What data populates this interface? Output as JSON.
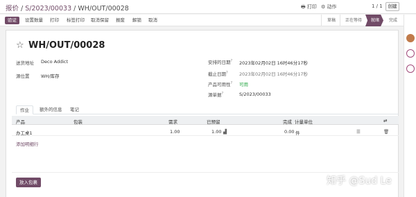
{
  "topbar": {
    "breadcrumb_root": "报价",
    "breadcrumb_sep1": "/",
    "breadcrumb_mid": "S/2023/00033",
    "breadcrumb_sep2": "/",
    "breadcrumb_current": "WH/OUT/00028",
    "print_label": "打印",
    "action_label": "动作",
    "pager": "1 / 1",
    "create_label": "创建"
  },
  "statusbar": {
    "validate": "验证",
    "set_quantities": "设置数量",
    "print": "打印",
    "print_labels": "标签打印",
    "cancel_reservation": "取消保留",
    "scrap": "报废",
    "unlock": "解锁",
    "cancel": "取消",
    "stages": [
      "草稿",
      "正在等待",
      "就绪",
      "完成"
    ],
    "active_stage": "就绪"
  },
  "record": {
    "title": "WH/OUT/00028",
    "delivery_address_label": "送货地址",
    "delivery_address": "Deco Addict",
    "source_location_label": "源位置",
    "source_location": "WH/库存",
    "scheduled_date_label": "安排的日期",
    "scheduled_date": "2023年02月02日 16时46分17秒",
    "deadline_label": "截止日期",
    "deadline": "2023年02月02日 16时46分17秒",
    "availability_label": "产品可用性",
    "availability": "可用",
    "source_document_label": "源单据",
    "source_document": "S/2023/00033"
  },
  "tabs": [
    "作业",
    "额外的信息",
    "笔记"
  ],
  "table": {
    "headers": {
      "product": "产品",
      "packaging": "包装",
      "demand": "需求",
      "reserved": "已预留",
      "done": "完成",
      "uom": "计量单位"
    },
    "rows": [
      {
        "product": "办工桌1",
        "demand": "1.00",
        "reserved": "1.00",
        "done": "0.00",
        "uom": "件"
      }
    ],
    "add_line": "添加明细行"
  },
  "put_in_pack": "放入包裹",
  "watermark": "知乎 @Sud Le"
}
